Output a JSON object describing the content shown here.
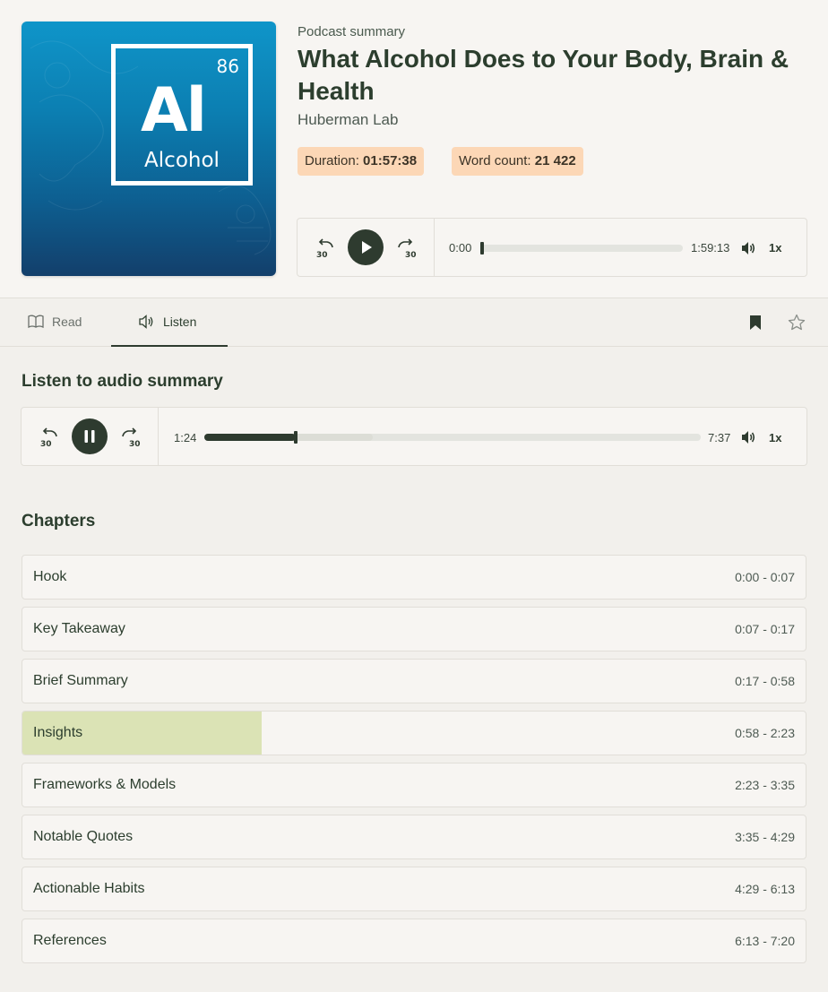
{
  "header": {
    "label": "Podcast summary",
    "title": "What Alcohol Does to Your Body, Brain & Health",
    "author": "Huberman Lab",
    "duration_label": "Duration:",
    "duration_value": "01:57:38",
    "wordcount_label": "Word count:",
    "wordcount_value": "21 422"
  },
  "cover": {
    "element_number": "86",
    "element_symbol": "Al",
    "element_name": "Alcohol",
    "colors": {
      "top": "#0f95c9",
      "bottom": "#133f6b"
    }
  },
  "main_player": {
    "back_icon": "rewind-30-icon",
    "play_icon": "play-icon",
    "forward_icon": "forward-30-icon",
    "skip_seconds": "30",
    "current_time": "0:00",
    "total_time": "1:59:13",
    "progress": 0.0,
    "volume_icon": "volume-icon",
    "speed": "1x"
  },
  "tabs": [
    {
      "label": "Read",
      "icon": "book-icon",
      "active": false
    },
    {
      "label": "Listen",
      "icon": "speaker-icon",
      "active": true
    }
  ],
  "toolbar": {
    "bookmark_icon": "bookmark-icon",
    "star_icon": "star-icon"
  },
  "audio_section": {
    "title": "Listen to audio summary",
    "back_icon": "rewind-30-icon",
    "pause_icon": "pause-icon",
    "forward_icon": "forward-30-icon",
    "skip_seconds": "30",
    "current_time": "1:24",
    "total_time": "7:37",
    "progress": 0.184,
    "buffered": 0.34,
    "volume_icon": "volume-icon",
    "speed": "1x"
  },
  "chapters_section": {
    "title": "Chapters",
    "items": [
      {
        "name": "Hook",
        "range": "0:00 - 0:07",
        "progress": 0
      },
      {
        "name": "Key Takeaway",
        "range": "0:07 - 0:17",
        "progress": 0
      },
      {
        "name": "Brief Summary",
        "range": "0:17 - 0:58",
        "progress": 0
      },
      {
        "name": "Insights",
        "range": "0:58 - 2:23",
        "progress": 0.305
      },
      {
        "name": "Frameworks & Models",
        "range": "2:23 - 3:35",
        "progress": 0
      },
      {
        "name": "Notable Quotes",
        "range": "3:35 - 4:29",
        "progress": 0
      },
      {
        "name": "Actionable Habits",
        "range": "4:29 - 6:13",
        "progress": 0
      },
      {
        "name": "References",
        "range": "6:13 - 7:20",
        "progress": 0
      }
    ]
  },
  "colors": {
    "accent": "#2e3b2f",
    "badge": "#fcd7b6",
    "chapter_progress": "#dbe3b5"
  }
}
